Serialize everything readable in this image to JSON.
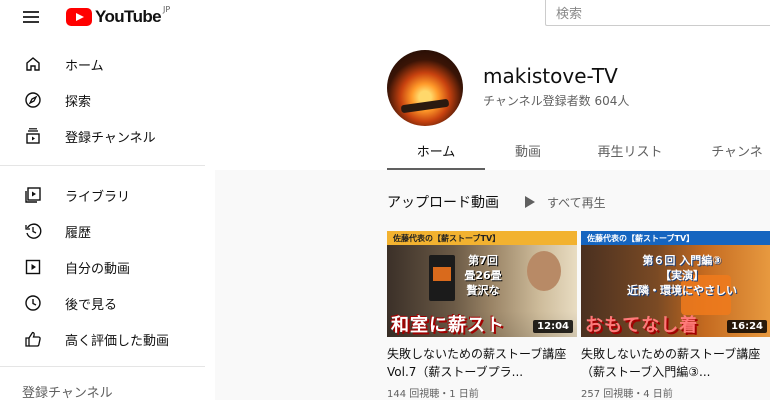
{
  "topbar": {
    "logo_text": "YouTube",
    "logo_country": "JP",
    "search_placeholder": "検索"
  },
  "sidebar": {
    "items": [
      {
        "label": "ホーム",
        "icon": "home-icon"
      },
      {
        "label": "探索",
        "icon": "compass-icon"
      },
      {
        "label": "登録チャンネル",
        "icon": "subscriptions-icon"
      },
      {
        "label": "ライブラリ",
        "icon": "library-icon"
      },
      {
        "label": "履歴",
        "icon": "history-icon"
      },
      {
        "label": "自分の動画",
        "icon": "your-videos-icon"
      },
      {
        "label": "後で見る",
        "icon": "clock-icon"
      },
      {
        "label": "高く評価した動画",
        "icon": "thumbs-up-icon"
      }
    ],
    "section_title": "登録チャンネル"
  },
  "channel": {
    "name": "makistove-TV",
    "subscribers": "チャンネル登録者数 604人",
    "tabs": [
      "ホーム",
      "動画",
      "再生リスト",
      "チャンネ"
    ]
  },
  "uploads": {
    "title": "アップロード動画",
    "play_all": "すべて再生",
    "videos": [
      {
        "thumb_top": "佐藤代表の【薪ストーブTV】",
        "thumb_caption": "第7回\n畳26畳\n贅沢な",
        "thumb_banner": "和室に薪スト",
        "duration": "12:04",
        "title": "失敗しないための薪ストーブ講座Vol.7（薪ストーブプラ...",
        "meta": "144 回視聴・1 日前"
      },
      {
        "thumb_top": "佐藤代表の【薪ストーブTV】",
        "thumb_caption": "第６回 入門編③\n【実演】\n近隣・環境にやさしい",
        "thumb_banner": "おもてなし着",
        "duration": "16:24",
        "title": "失敗しないための薪ストーブ講座（薪ストーブ入門編③...",
        "meta": "257 回視聴・4 日前"
      }
    ]
  },
  "colors": {
    "brand_red": "#ff0000",
    "thumb1_top": "#f2b230",
    "thumb2_top": "#1565c0",
    "banner_red": "#e5261c"
  }
}
